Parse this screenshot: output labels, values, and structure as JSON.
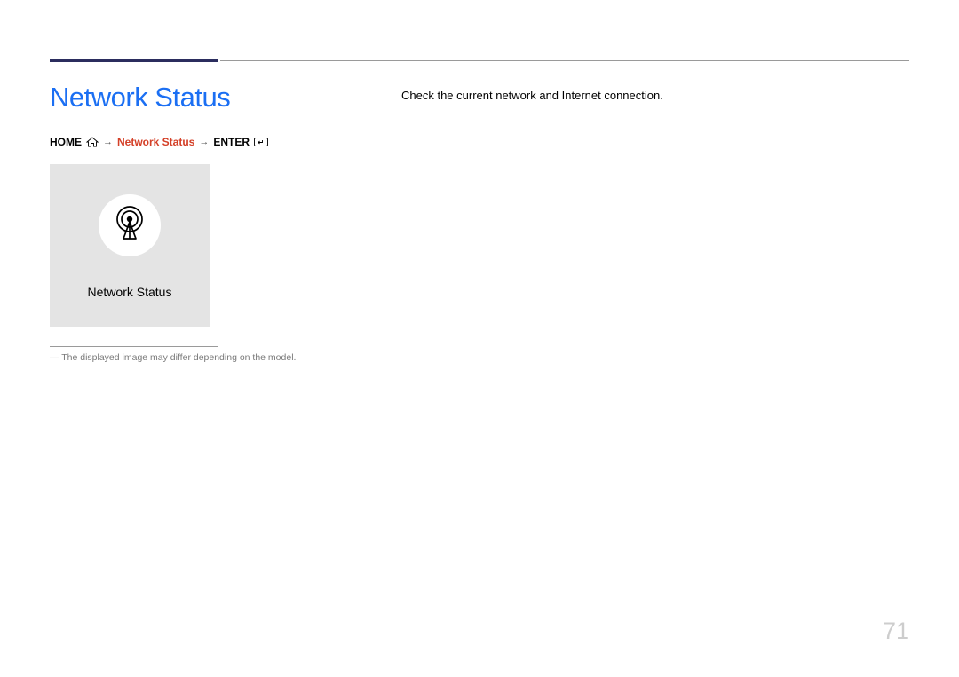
{
  "header": {
    "title": "Network Status"
  },
  "breadcrumb": {
    "home": "HOME",
    "path": "Network Status",
    "enter": "ENTER"
  },
  "main": {
    "description": "Check the current network and Internet connection."
  },
  "tile": {
    "label": "Network Status",
    "icon_name": "antenna-broadcast-icon"
  },
  "footnote": "― The displayed image may differ depending on the model.",
  "page_number": "71"
}
